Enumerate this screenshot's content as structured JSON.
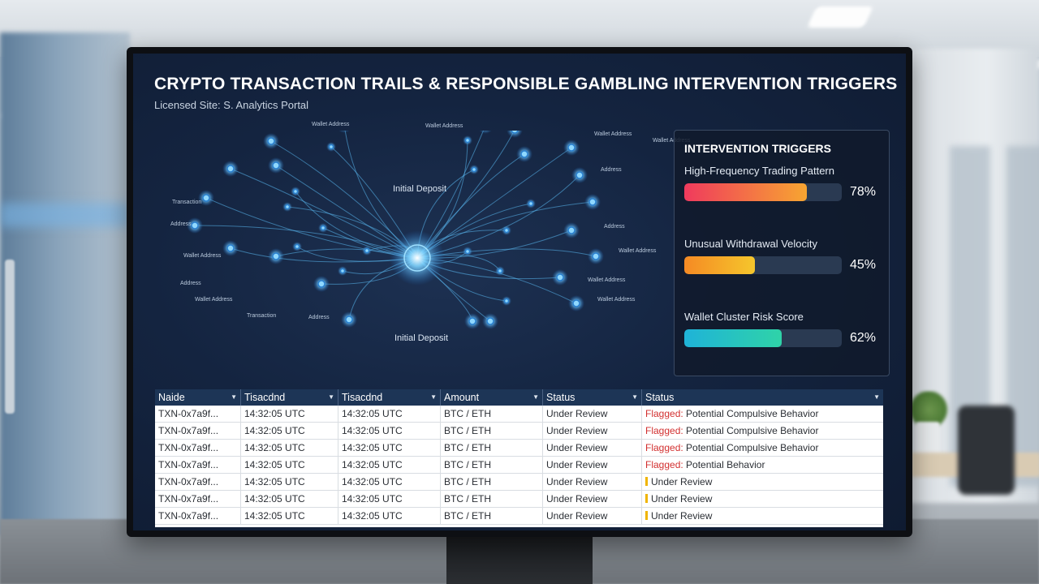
{
  "header": {
    "title": "CRYPTO TRANSACTION TRAILS & RESPONSIBLE GAMBLING INTERVENTION TRIGGERS",
    "subtitle": "Licensed Site: S. Analytics Portal"
  },
  "network": {
    "center_label_top": "Initial Deposit",
    "center_label_bottom": "Initial Deposit",
    "node_labels": [
      "Wallet Address",
      "Wallet Address",
      "Wallet Address",
      "Wallet Address",
      "Transaction",
      "Address",
      "Wallet Address",
      "Address",
      "Wallet Address",
      "Address",
      "Address",
      "Wallet Address",
      "Wallet Address",
      "Wallet Address",
      "Transaction",
      "Address"
    ]
  },
  "triggers": {
    "title": "INTERVENTION TRIGGERS",
    "items": [
      {
        "label": "High-Frequency Trading Pattern",
        "value_text": "78%",
        "value": 0.78,
        "gradient": [
          "#ef3a5d",
          "#f7a531"
        ]
      },
      {
        "label": "Unusual Withdrawal Velocity",
        "value_text": "45%",
        "value": 0.45,
        "gradient": [
          "#f58a24",
          "#f5c62c"
        ]
      },
      {
        "label": "Wallet Cluster Risk Score",
        "value_text": "62%",
        "value": 0.62,
        "gradient": [
          "#1fb3d8",
          "#2fd3a8"
        ]
      }
    ]
  },
  "table": {
    "headers": [
      "Naide",
      "Tisacdnd",
      "Tisacdnd",
      "Amount",
      "Status",
      "Status"
    ],
    "rows": [
      {
        "id": "TXN-0x7a9f...",
        "t1": "14:32:05 UTC",
        "t2": "14:32:05 UTC",
        "amount": "BTC / ETH",
        "status": "Under Review",
        "flag": "Flagged:",
        "detail": "Potential Compulsive Behavior"
      },
      {
        "id": "TXN-0x7a9f...",
        "t1": "14:32:05 UTC",
        "t2": "14:32:05 UTC",
        "amount": "BTC / ETH",
        "status": "Under Review",
        "flag": "Flagged:",
        "detail": "Potential Compulsive Behavior"
      },
      {
        "id": "TXN-0x7a9f...",
        "t1": "14:32:05 UTC",
        "t2": "14:32:05 UTC",
        "amount": "BTC / ETH",
        "status": "Under Review",
        "flag": "Flagged:",
        "detail": "Potential Compulsive Behavior"
      },
      {
        "id": "TXN-0x7a9f...",
        "t1": "14:32:05 UTC",
        "t2": "14:32:05 UTC",
        "amount": "BTC / ETH",
        "status": "Under Review",
        "flag": "Flagged:",
        "detail": "Potential Behavior"
      },
      {
        "id": "TXN-0x7a9f...",
        "t1": "14:32:05 UTC",
        "t2": "14:32:05 UTC",
        "amount": "BTC / ETH",
        "status": "Under Review",
        "flag": "",
        "detail": "Under Review"
      },
      {
        "id": "TXN-0x7a9f...",
        "t1": "14:32:05 UTC",
        "t2": "14:32:05 UTC",
        "amount": "BTC / ETH",
        "status": "Under Review",
        "flag": "",
        "detail": "Under Review"
      },
      {
        "id": "TXN-0x7a9f...",
        "t1": "14:32:05 UTC",
        "t2": "14:32:05 UTC",
        "amount": "BTC / ETH",
        "status": "Under Review",
        "flag": "",
        "detail": "Under Review"
      }
    ]
  },
  "colors": {
    "screen_bg": "#142440",
    "node_glow": "#4fb8ff",
    "table_header": "#1d3556",
    "flag_red": "#d22f2f",
    "review_yellow": "#f0b400"
  },
  "icons": {
    "dropdown": "caret-down-icon"
  }
}
